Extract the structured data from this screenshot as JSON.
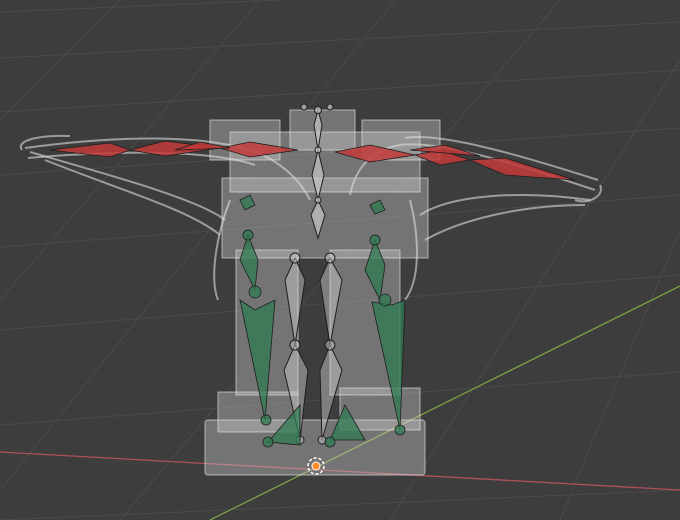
{
  "viewport": {
    "name": "3D Viewport",
    "background": "#3d3d3d",
    "grid_color": "#4a4a4a",
    "x_axis_color": "#b0505a",
    "y_axis_color": "#7aa040"
  },
  "scene": {
    "model_color": "#cfcfcf",
    "bone_outline_color": "#1e1e1e",
    "bone_fill_color": "#c8c8c8",
    "arm_bone_color": "#c23a3a",
    "leg_ik_color": "#2f7a52",
    "origin_color": "#ff8a2a"
  }
}
